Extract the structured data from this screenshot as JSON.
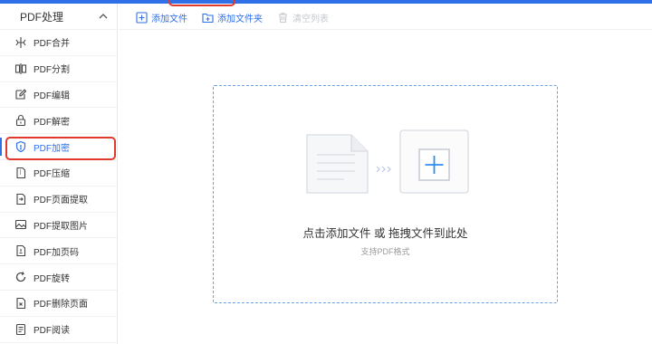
{
  "sidebar": {
    "title": "PDF处理",
    "items": [
      {
        "label": "PDF合并",
        "icon": "merge-icon"
      },
      {
        "label": "PDF分割",
        "icon": "split-icon"
      },
      {
        "label": "PDF编辑",
        "icon": "edit-icon"
      },
      {
        "label": "PDF解密",
        "icon": "unlock-icon"
      },
      {
        "label": "PDF加密",
        "icon": "shield-icon",
        "active": true
      },
      {
        "label": "PDF压缩",
        "icon": "compress-icon"
      },
      {
        "label": "PDF页面提取",
        "icon": "extract-page-icon"
      },
      {
        "label": "PDF提取图片",
        "icon": "image-icon"
      },
      {
        "label": "PDF加页码",
        "icon": "page-number-icon"
      },
      {
        "label": "PDF旋转",
        "icon": "rotate-icon"
      },
      {
        "label": "PDF删除页面",
        "icon": "delete-page-icon"
      },
      {
        "label": "PDF阅读",
        "icon": "read-icon"
      }
    ]
  },
  "toolbar": {
    "add_file": "添加文件",
    "add_folder": "添加文件夹",
    "clear_list": "清空列表"
  },
  "dropzone": {
    "title": "点击添加文件 或 拖拽文件到此处",
    "subtitle": "支持PDF格式"
  },
  "colors": {
    "accent": "#2f6fe8",
    "highlight": "#e03a2f",
    "disabled": "#c4c8cf"
  }
}
